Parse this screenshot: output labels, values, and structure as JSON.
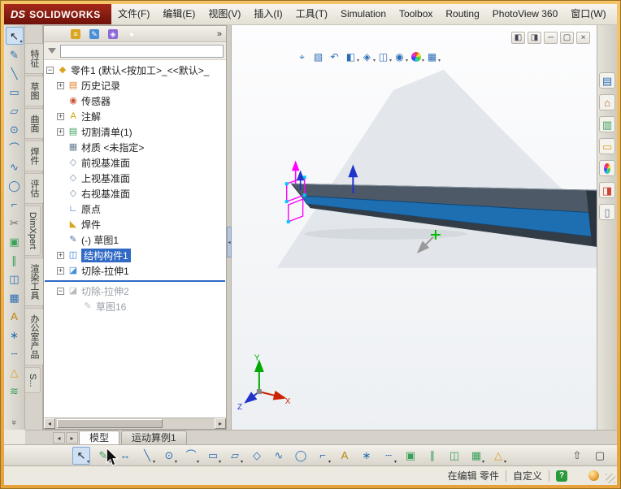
{
  "window": {
    "frame_color": "#E8A23B"
  },
  "menubar": {
    "logo": {
      "prefix": "DS",
      "name": "SOLIDWORKS"
    },
    "items": [
      {
        "name": "menu-file",
        "label": "文件(F)"
      },
      {
        "name": "menu-edit",
        "label": "编辑(E)"
      },
      {
        "name": "menu-view",
        "label": "视图(V)"
      },
      {
        "name": "menu-insert",
        "label": "插入(I)"
      },
      {
        "name": "menu-tools",
        "label": "工具(T)"
      },
      {
        "name": "menu-simulation",
        "label": "Simulation"
      },
      {
        "name": "menu-toolbox",
        "label": "Toolbox"
      },
      {
        "name": "menu-routing",
        "label": "Routing"
      },
      {
        "name": "menu-photoview",
        "label": "PhotoView 360"
      },
      {
        "name": "menu-window",
        "label": "窗口(W)"
      }
    ]
  },
  "left_toolbar": {
    "overflow_chevron": "»",
    "icons": [
      {
        "name": "select-tool-icon",
        "glyph": "↖",
        "color": "#222222",
        "caret": "▾",
        "state": "pressed"
      },
      {
        "name": "sketch-icon",
        "glyph": "✎",
        "color": "#2a6db5"
      },
      {
        "name": "line-icon",
        "glyph": "╲",
        "color": "#2a6db5"
      },
      {
        "name": "rectangle-icon",
        "glyph": "▭",
        "color": "#2a6db5"
      },
      {
        "name": "slot-icon",
        "glyph": "▱",
        "color": "#2a6db5"
      },
      {
        "name": "circle-icon",
        "glyph": "⊙",
        "color": "#2a6db5"
      },
      {
        "name": "arc-icon",
        "glyph": "⌒",
        "color": "#2a6db5"
      },
      {
        "name": "spline-icon",
        "glyph": "∿",
        "color": "#2a6db5"
      },
      {
        "name": "ellipse-icon",
        "glyph": "◯",
        "color": "#2a6db5"
      },
      {
        "name": "sketch-fillet-icon",
        "glyph": "⌐",
        "color": "#2a6db5"
      },
      {
        "name": "trim-entities-icon",
        "glyph": "✂",
        "color": "#666666"
      },
      {
        "name": "convert-entities-icon",
        "glyph": "▣",
        "color": "#3aa05a"
      },
      {
        "name": "offset-entities-icon",
        "glyph": "∥",
        "color": "#3aa05a"
      },
      {
        "name": "mirror-entities-icon",
        "glyph": "◫",
        "color": "#2a6db5"
      },
      {
        "name": "linear-pattern-icon",
        "glyph": "▦",
        "color": "#2a6db5"
      },
      {
        "name": "sketch-text-icon",
        "glyph": "A",
        "color": "#b8860b"
      },
      {
        "name": "point-icon",
        "glyph": "∗",
        "color": "#2a6db5"
      },
      {
        "name": "centerline-icon",
        "glyph": "┄",
        "color": "#2a6db5"
      },
      {
        "name": "display-relations-icon",
        "glyph": "△",
        "color": "#d9a520"
      },
      {
        "name": "quick-snaps-icon",
        "glyph": "≋",
        "color": "#3aa05a"
      }
    ]
  },
  "side_tabs": {
    "tabs": [
      {
        "name": "tab-features",
        "label": "特征"
      },
      {
        "name": "tab-sketch",
        "label": "草图"
      },
      {
        "name": "tab-surfaces",
        "label": "曲面"
      },
      {
        "name": "tab-weldments",
        "label": "焊件"
      },
      {
        "name": "tab-evaluate",
        "label": "评估"
      },
      {
        "name": "tab-dimxpert",
        "label": "DimXpert"
      },
      {
        "name": "tab-render-tools",
        "label": "渲染工具"
      },
      {
        "name": "tab-office-products",
        "label": "办公室产品"
      },
      {
        "name": "tab-solidworks-addins",
        "label": "S..."
      }
    ]
  },
  "panel": {
    "overflow": "»",
    "tabs": [
      {
        "name": "tab-featuremanager",
        "glyph": "≡",
        "bg": "#d9a520"
      },
      {
        "name": "tab-propertymanager",
        "glyph": "✎",
        "bg": "#4a90d9"
      },
      {
        "name": "tab-configurationmanager",
        "glyph": "◈",
        "bg": "#8c6bd9"
      },
      {
        "name": "tab-displaymanager",
        "glyph": "●",
        "ball": "y",
        "bg": ""
      }
    ],
    "filter": {
      "value": ""
    },
    "hscroll": {
      "left": "◂",
      "right": "▸"
    },
    "tree": {
      "items": [
        {
          "label": "零件1 (默认<按加工>_<<默认>_",
          "glyph": "◆",
          "color": "#d9a520",
          "expand": "−",
          "indent": "0"
        },
        {
          "label": "历史记录",
          "glyph": "▤",
          "color": "#e07b20",
          "expand": "+",
          "indent": "1"
        },
        {
          "label": "传感器",
          "glyph": "◉",
          "color": "#cc5533",
          "expand": "",
          "indent": "1"
        },
        {
          "label": "注解",
          "glyph": "A",
          "color": "#c9a400",
          "expand": "+",
          "indent": "1"
        },
        {
          "label": "切割清单(1)",
          "glyph": "▤",
          "color": "#3aa05a",
          "expand": "+",
          "indent": "1"
        },
        {
          "label": "材质 <未指定>",
          "glyph": "▦",
          "color": "#6a7f95",
          "expand": "",
          "indent": "1"
        },
        {
          "label": "前视基准面",
          "glyph": "◇",
          "color": "#7a8fa5",
          "expand": "",
          "indent": "1"
        },
        {
          "label": "上视基准面",
          "glyph": "◇",
          "color": "#7a8fa5",
          "expand": "",
          "indent": "1"
        },
        {
          "label": "右视基准面",
          "glyph": "◇",
          "color": "#7a8fa5",
          "expand": "",
          "indent": "1"
        },
        {
          "label": "原点",
          "glyph": "∟",
          "color": "#2255cc",
          "expand": "",
          "indent": "1"
        },
        {
          "label": "焊件",
          "glyph": "◣",
          "color": "#d9a520",
          "expand": "",
          "indent": "1"
        },
        {
          "label": "(-) 草图1",
          "glyph": "✎",
          "color": "#4a6fa5",
          "expand": "",
          "indent": "1"
        },
        {
          "label": "结构构件1",
          "glyph": "◫",
          "color": "#2a7fd4",
          "expand": "+",
          "indent": "1",
          "state": "selected"
        },
        {
          "label": "切除-拉伸1",
          "glyph": "◪",
          "color": "#4a90d9",
          "expand": "+",
          "indent": "1"
        }
      ],
      "edit_items": [
        {
          "label": "切除-拉伸2",
          "glyph": "◪",
          "color": "#9aa5b0",
          "expand": "−",
          "indent": "1",
          "state": "grayed"
        },
        {
          "label": "草图16",
          "glyph": "✎",
          "color": "#9aa5b0",
          "expand": "",
          "indent": "2",
          "state": "grayed"
        }
      ]
    }
  },
  "splitter": {
    "glyph": "◂"
  },
  "viewport": {
    "headsup": [
      {
        "name": "zoom-fit-icon",
        "glyph": "⌖",
        "color": "#2a6db5"
      },
      {
        "name": "zoom-area-icon",
        "glyph": "▧",
        "color": "#2a6db5"
      },
      {
        "name": "previous-view-icon",
        "glyph": "↶",
        "color": "#2a6db5"
      },
      {
        "name": "section-view-icon",
        "glyph": "◧",
        "color": "#2a6db5",
        "caret": "▾"
      },
      {
        "name": "view-orientation-icon",
        "glyph": "◈",
        "color": "#2a6db5",
        "caret": "▾"
      },
      {
        "name": "display-style-icon",
        "glyph": "◫",
        "color": "#2a6db5",
        "caret": "▾"
      },
      {
        "name": "hide-show-items-icon",
        "glyph": "◉",
        "color": "#2a6db5",
        "caret": "▾"
      },
      {
        "name": "edit-appearance-icon",
        "glyph": "●",
        "ball": "y",
        "caret": "▾"
      },
      {
        "name": "apply-scene-icon",
        "glyph": "▦",
        "color": "#2a6db5",
        "caret": "▾"
      }
    ],
    "doc_controls": [
      {
        "name": "pane-left-icon",
        "glyph": "◧"
      },
      {
        "name": "pane-right-icon",
        "glyph": "◨"
      },
      {
        "name": "doc-minimize-button",
        "glyph": "─"
      },
      {
        "name": "doc-restore-button",
        "glyph": "▢"
      },
      {
        "name": "doc-close-button",
        "glyph": "×"
      }
    ],
    "triad": {
      "x": "X",
      "y": "Y",
      "z": "Z",
      "x_color": "#cc2200",
      "y_color": "#00aa00",
      "z_color": "#2233cc"
    },
    "model": {
      "backdrop": "#dde2e7",
      "top_face": "#4d5966",
      "selected_face": "#1e6fb2",
      "bottom_face": "#333d48",
      "end_face": "#2b3540",
      "sketch_color": "#ff00ff"
    }
  },
  "task_pane": {
    "icons": [
      {
        "name": "solidworks-resources-icon",
        "glyph": "▤",
        "color": "#2a6db5"
      },
      {
        "name": "design-library-icon",
        "glyph": "⌂",
        "color": "#b05c20"
      },
      {
        "name": "file-explorer-icon",
        "glyph": "▥",
        "color": "#3aa05a"
      },
      {
        "name": "view-palette-icon",
        "glyph": "▭",
        "color": "#d9a520"
      },
      {
        "name": "appearances-scenes-icon",
        "glyph": "●",
        "ball": "y"
      },
      {
        "name": "custom-properties-icon",
        "glyph": "◨",
        "color": "#cc4433"
      },
      {
        "name": "forum-icon",
        "glyph": "▯",
        "color": "#667788"
      }
    ]
  },
  "tabs_row": {
    "scroll_left": "◂",
    "scroll_right": "▸",
    "tabs": [
      {
        "name": "tab-model",
        "label": "模型",
        "state": "active"
      },
      {
        "name": "tab-motion-study",
        "label": "运动算例1"
      }
    ]
  },
  "bottom_toolbar": {
    "icons": [
      {
        "name": "select-cursor-icon",
        "glyph": "↖",
        "color": "#222222",
        "caret": "▾",
        "state": "pressed"
      },
      {
        "name": "sketch-icon",
        "glyph": "✎",
        "color": "#3aa05a",
        "caret": "▾"
      },
      {
        "name": "smart-dimension-icon",
        "glyph": "↔",
        "color": "#2a6db5"
      },
      {
        "name": "line-icon",
        "glyph": "╲",
        "color": "#2a6db5",
        "caret": "▾"
      },
      {
        "name": "circle-icon",
        "glyph": "⊙",
        "color": "#2a6db5",
        "caret": "▾"
      },
      {
        "name": "arc-icon",
        "glyph": "⌒",
        "color": "#2a6db5",
        "caret": "▾"
      },
      {
        "name": "rectangle-icon",
        "glyph": "▭",
        "color": "#2a6db5",
        "caret": "▾"
      },
      {
        "name": "slot-icon",
        "glyph": "▱",
        "color": "#2a6db5",
        "caret": "▾"
      },
      {
        "name": "polygon-icon",
        "glyph": "◇",
        "color": "#2a6db5"
      },
      {
        "name": "spline-icon",
        "glyph": "∿",
        "color": "#2a6db5"
      },
      {
        "name": "ellipse-icon",
        "glyph": "◯",
        "color": "#2a6db5"
      },
      {
        "name": "fillet-icon",
        "glyph": "⌐",
        "color": "#2a6db5",
        "caret": "▾"
      },
      {
        "name": "text-icon",
        "glyph": "A",
        "color": "#b8860b"
      },
      {
        "name": "point-icon",
        "glyph": "∗",
        "color": "#2a6db5"
      },
      {
        "name": "centerline-icon",
        "glyph": "┄",
        "color": "#2a6db5",
        "caret": "▾"
      },
      {
        "name": "convert-entities-icon",
        "glyph": "▣",
        "color": "#3aa05a"
      },
      {
        "name": "offset-entities-icon",
        "glyph": "∥",
        "color": "#3aa05a"
      },
      {
        "name": "mirror-entities-icon",
        "glyph": "◫",
        "color": "#3aa05a"
      },
      {
        "name": "linear-pattern-icon",
        "glyph": "▦",
        "color": "#3aa05a",
        "caret": "▾"
      },
      {
        "name": "display-relations-icon",
        "glyph": "△",
        "color": "#d9a520",
        "caret": "▾"
      }
    ],
    "right_icons": [
      {
        "name": "collapse-toolbar-icon",
        "glyph": "⇧",
        "color": "#444444"
      },
      {
        "name": "fullscreen-icon",
        "glyph": "▢",
        "color": "#444444"
      }
    ]
  },
  "status_bar": {
    "editing": "在编辑 零件",
    "customize": "自定义",
    "help": "?"
  }
}
